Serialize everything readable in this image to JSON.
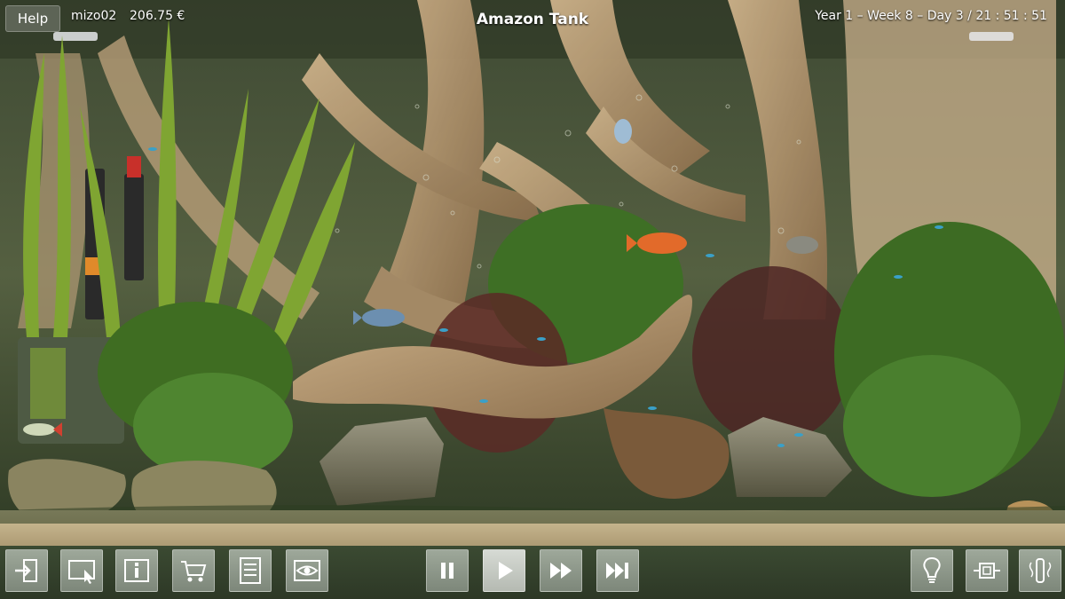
{
  "header": {
    "help_label": "Help",
    "username": "mizo02",
    "balance": "206.75 €",
    "tank_name": "Amazon Tank",
    "datetime": "Year 1 – Week 8 – Day 3 / 21 : 51 : 51"
  },
  "toolbar": {
    "left_icons": [
      "exit-icon",
      "window-cursor-icon",
      "info-icon",
      "shopping-cart-icon",
      "checklist-icon",
      "eye-icon"
    ],
    "playback_icons": [
      "pause-icon",
      "play-icon",
      "fast-forward-icon",
      "skip-forward-icon"
    ],
    "right_icons": [
      "light-bulb-icon",
      "filter-icon",
      "heater-icon"
    ]
  },
  "colors": {
    "water": "#3c4a30",
    "sand": "#c8b690",
    "wood": "#a88c68",
    "plant": "#5f8a2a",
    "toolbar": "#34412c"
  }
}
